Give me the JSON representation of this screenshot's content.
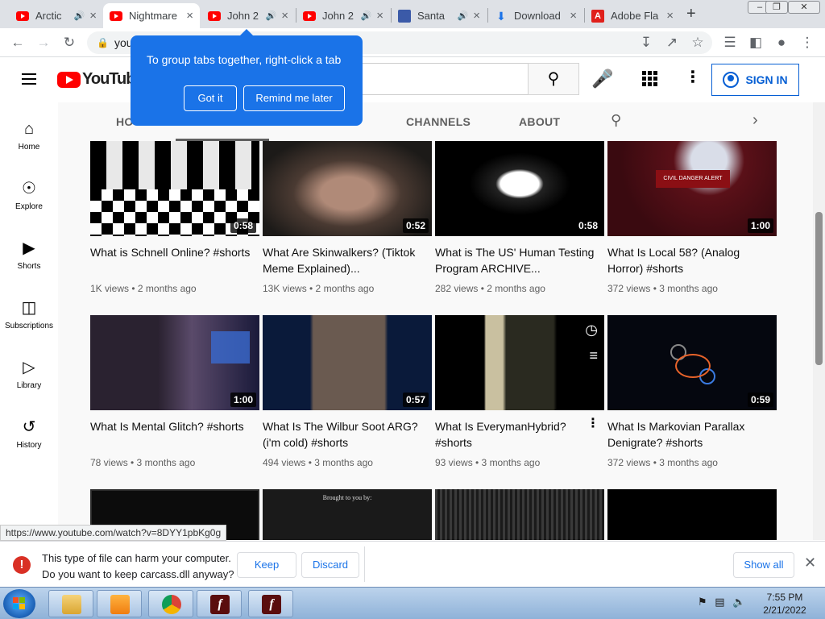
{
  "browser": {
    "tabs": [
      {
        "label": "Arctic",
        "favicon": "youtube-icon",
        "audio": true
      },
      {
        "label": "Nightmare",
        "favicon": "youtube-icon",
        "audio": false,
        "active": true
      },
      {
        "label": "John 2",
        "favicon": "youtube-icon",
        "audio": true
      },
      {
        "label": "John 2",
        "favicon": "youtube-icon",
        "audio": true
      },
      {
        "label": "Santa",
        "favicon": "santa-icon",
        "audio": true
      },
      {
        "label": "Download",
        "favicon": "download-icon",
        "audio": false
      },
      {
        "label": "Adobe Fla",
        "favicon": "adobe-icon",
        "audio": false
      }
    ],
    "omnibox_text": "you",
    "status_url": "https://www.youtube.com/watch?v=8DYY1pbKg0g"
  },
  "tooltip": {
    "text": "To group tabs together, right-click a tab",
    "got_it": "Got it",
    "remind": "Remind me later"
  },
  "youtube": {
    "logo_text": "YouTube",
    "sign_in": "SIGN IN",
    "guide": [
      {
        "label": "Home",
        "icon": "home-icon"
      },
      {
        "label": "Explore",
        "icon": "compass-icon"
      },
      {
        "label": "Shorts",
        "icon": "shorts-icon"
      },
      {
        "label": "Subscriptions",
        "icon": "subscriptions-icon"
      },
      {
        "label": "Library",
        "icon": "library-icon"
      },
      {
        "label": "History",
        "icon": "history-icon"
      }
    ],
    "channel_tabs": [
      "HO",
      "CHANNELS",
      "ABOUT"
    ],
    "videos": [
      {
        "title": "What is Schnell Online? #shorts",
        "duration": "0:58",
        "meta": "1K views • 2 months ago"
      },
      {
        "title": "What Are Skinwalkers? (Tiktok Meme Explained)...",
        "duration": "0:52",
        "meta": "13K views • 2 months ago"
      },
      {
        "title": "What is The US' Human Testing Program ARCHIVE...",
        "duration": "0:58",
        "meta": "282 views • 2 months ago"
      },
      {
        "title": "What Is Local 58? (Analog Horror) #shorts",
        "duration": "1:00",
        "meta": "372 views • 3 months ago"
      },
      {
        "title": "What Is Mental Glitch? #shorts",
        "duration": "1:00",
        "meta": "78 views • 3 months ago"
      },
      {
        "title": "What Is The Wilbur Soot ARG? (i'm cold) #shorts",
        "duration": "0:57",
        "meta": "494 views • 3 months ago"
      },
      {
        "title": "What Is EverymanHybrid? #shorts",
        "duration": "",
        "meta": "93 views • 3 months ago"
      },
      {
        "title": "What Is Markovian Parallax Denigrate? #shorts",
        "duration": "0:59",
        "meta": "372 views • 3 months ago"
      }
    ],
    "thumb_texts": {
      "local58": "CIVIL DANGER ALERT",
      "brought": "Brought to you by:"
    }
  },
  "download_bar": {
    "line1": "This type of file can harm your computer.",
    "line2": "Do you want to keep carcass.dll anyway?",
    "keep": "Keep",
    "discard": "Discard",
    "show_all": "Show all"
  },
  "taskbar": {
    "time": "7:55 PM",
    "date": "2/21/2022"
  }
}
